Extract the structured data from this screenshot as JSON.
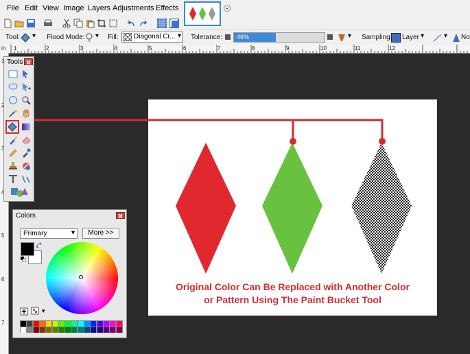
{
  "menu": {
    "items": [
      "File",
      "Edit",
      "View",
      "Image",
      "Layers",
      "Adjustments",
      "Effects"
    ]
  },
  "toolbar": {
    "tool_label": "Tool:",
    "flood_mode_label": "Flood Mode:",
    "fill_label": "Fill:",
    "fill_value": "Diagonal Cr...",
    "tolerance_label": "Tolerance:",
    "tolerance_value": "46%",
    "tolerance_fraction": 0.46,
    "sampling_label": "Sampling:",
    "sampling_value": "Layer",
    "extra_label": "No"
  },
  "ruler": {
    "top_numbers": [
      "in",
      "1",
      "2",
      "3",
      "4",
      "5",
      "6",
      "7",
      "8",
      "9",
      "10",
      "11",
      "12"
    ],
    "left_numbers": [
      "1",
      "2",
      "3",
      "4",
      "5",
      "6",
      "7"
    ]
  },
  "canvas": {
    "caption_line1": "Original Color Can Be Replaced with Another Color",
    "caption_line2": "or Pattern Using The Paint Bucket Tool",
    "colors": {
      "red": "#e0282e",
      "green": "#69c23f",
      "callout": "#d52b2f"
    }
  },
  "tools_window": {
    "title": "Tools"
  },
  "colors_window": {
    "title": "Colors",
    "mode_value": "Primary",
    "more_label": "More >>"
  },
  "palette": [
    "#000000",
    "#404040",
    "#ff0000",
    "#ff6a00",
    "#ffd800",
    "#b6ff00",
    "#4cff00",
    "#00ff21",
    "#00ff90",
    "#00ffff",
    "#0094ff",
    "#0026ff",
    "#4800ff",
    "#b200ff",
    "#ff00dc",
    "#ff006e",
    "#ffffff",
    "#808080",
    "#7f0000",
    "#7f3300",
    "#7f6a00",
    "#5b7f00",
    "#267f00",
    "#007f0e",
    "#007f46",
    "#007f7f",
    "#004a7f",
    "#00137f",
    "#21007f",
    "#57007f",
    "#7f006e",
    "#7f0037"
  ]
}
